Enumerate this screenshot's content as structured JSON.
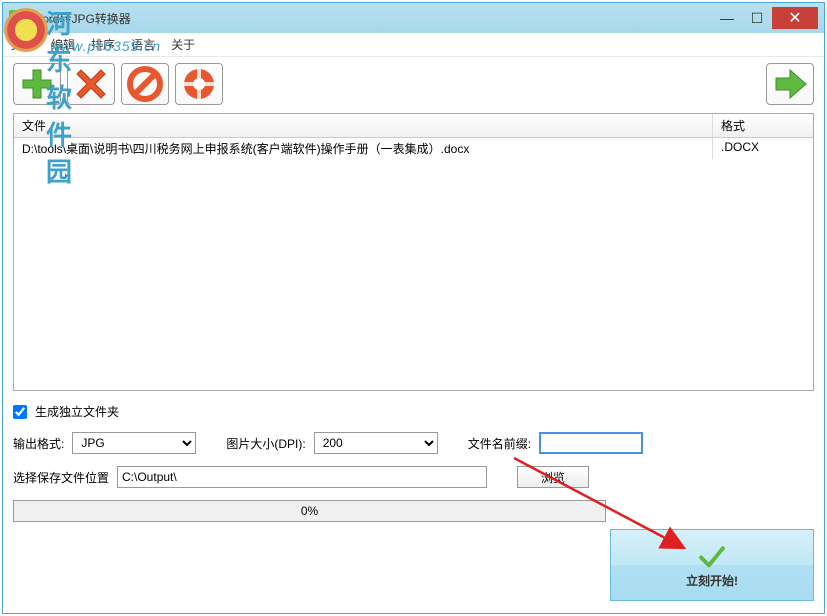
{
  "window": {
    "title": "Word转JPG转换器"
  },
  "menubar": {
    "file": "文件",
    "edit": "编辑",
    "sort": "排序",
    "language": "语言",
    "about": "关于"
  },
  "watermark": {
    "text": "河东软件园",
    "url": "www.pc0359.cn"
  },
  "toolbar": {
    "add_icon": "add",
    "remove_icon": "remove",
    "clear_icon": "clear",
    "help_icon": "help",
    "start_icon": "start"
  },
  "file_list": {
    "col_file": "文件",
    "col_format": "格式",
    "rows": [
      {
        "path": "D:\\tools\\桌面\\说明书\\四川税务网上申报系统(客户端软件)操作手册（一表集成）.docx",
        "format": ".DOCX"
      }
    ]
  },
  "options": {
    "create_folder_label": "生成独立文件夹",
    "output_format_label": "输出格式:",
    "output_format_value": "JPG",
    "dpi_label": "图片大小(DPI):",
    "dpi_value": "200",
    "prefix_label": "文件名前缀:",
    "prefix_value": "",
    "save_location_label": "选择保存文件位置",
    "save_location_value": "C:\\Output\\",
    "browse_label": "浏览"
  },
  "progress": {
    "text": "0%"
  },
  "start_button": {
    "label": "立刻开始!"
  }
}
